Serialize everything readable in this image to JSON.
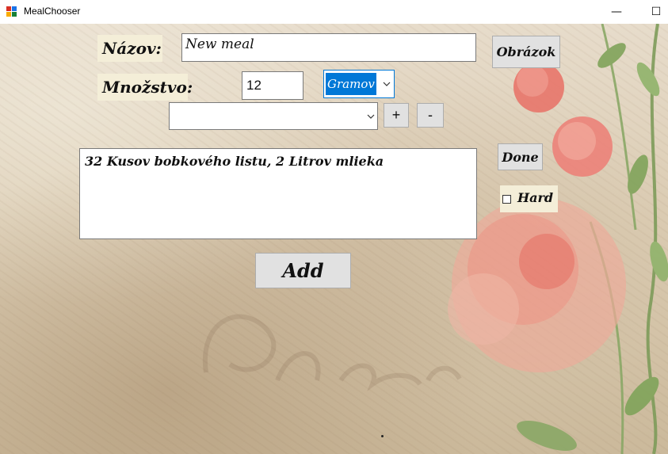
{
  "window": {
    "title": "MealChooser",
    "minimize_glyph": "—",
    "maximize_glyph": "☐"
  },
  "form": {
    "name_label": "Názov:",
    "name_value": "New meal",
    "image_button": "Obrázok",
    "quantity_label": "Množstvo:",
    "quantity_value": "12",
    "unit_selected": "Gramov",
    "ingredient_selected": "",
    "plus_button": "+",
    "minus_button": "-",
    "ingredients_text": "32 Kusov bobkového listu, 2 Litrov mlieka",
    "done_button": "Done",
    "hard_label": "Hard",
    "hard_checked": false,
    "add_button": "Add"
  },
  "icons": {
    "app": "window-app-icon",
    "dropdown": "chevron-down-icon"
  },
  "colors": {
    "selection": "#0078d7",
    "button_face": "#e1e1e1",
    "label_bg": "#f4eed8"
  }
}
